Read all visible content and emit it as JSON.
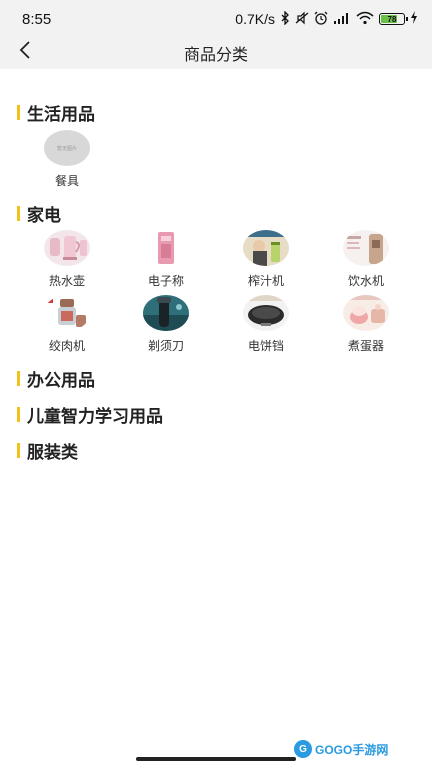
{
  "status_bar": {
    "time": "8:55",
    "network_speed": "0.7K/s",
    "battery_level": "78",
    "battery_fraction": 0.78,
    "icons": [
      "bluetooth-icon",
      "mute-icon",
      "alarm-icon",
      "signal-icon",
      "wifi-icon",
      "battery-icon",
      "charging-icon"
    ]
  },
  "nav": {
    "title": "商品分类",
    "back_icon": "chevron-left-icon"
  },
  "sections": [
    {
      "title": "生活用品",
      "items": [
        {
          "label": "餐具",
          "image": "placeholder",
          "placeholder_text": "暂无图片"
        }
      ]
    },
    {
      "title": "家电",
      "items": [
        {
          "label": "热水壶",
          "image": "kettle"
        },
        {
          "label": "电子称",
          "image": "scale"
        },
        {
          "label": "榨汁机",
          "image": "juicer"
        },
        {
          "label": "饮水机",
          "image": "dispenser"
        },
        {
          "label": "绞肉机",
          "image": "grinder"
        },
        {
          "label": "剃须刀",
          "image": "shaver"
        },
        {
          "label": "电饼铛",
          "image": "griddle"
        },
        {
          "label": "煮蛋器",
          "image": "egg-cooker"
        }
      ]
    },
    {
      "title": "办公用品",
      "items": []
    },
    {
      "title": "儿童智力学习用品",
      "items": []
    },
    {
      "title": "服装类",
      "items": []
    }
  ],
  "watermark": {
    "logo": "G",
    "text": "GOGO手游网"
  },
  "colors": {
    "accent": "#f2c21b",
    "header_bg": "#f2f2f2",
    "watermark": "#2a9be0"
  }
}
